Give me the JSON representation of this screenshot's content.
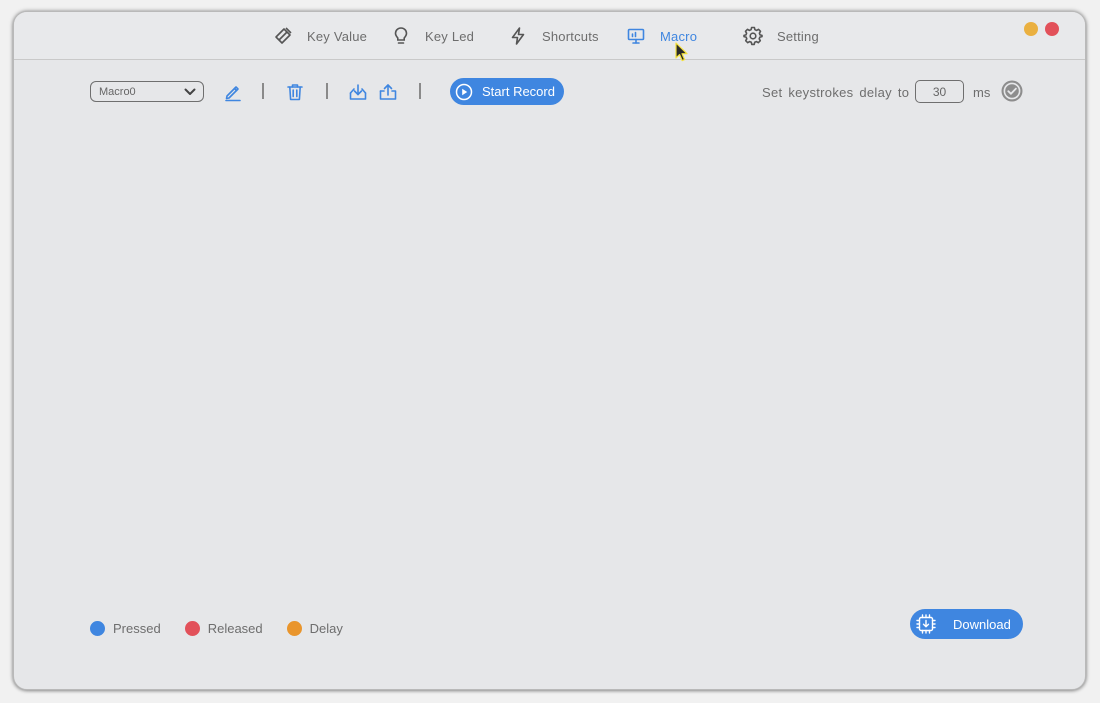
{
  "nav": {
    "tabs": [
      {
        "label": "Key Value",
        "icon": "key-value-icon"
      },
      {
        "label": "Key Led",
        "icon": "bulb-icon"
      },
      {
        "label": "Shortcuts",
        "icon": "lightning-icon"
      },
      {
        "label": "Macro",
        "icon": "monitor-icon",
        "active": true
      },
      {
        "label": "Setting",
        "icon": "gear-icon"
      }
    ]
  },
  "toolbar": {
    "macro_select": {
      "value": "Macro0"
    },
    "record_label": "Start Record",
    "delay_label": "Set keystrokes delay to",
    "delay_value": "30",
    "delay_unit": "ms"
  },
  "legend": {
    "items": [
      {
        "label": "Pressed",
        "color": "#3f86e0"
      },
      {
        "label": "Released",
        "color": "#e2515a"
      },
      {
        "label": "Delay",
        "color": "#e9952c"
      }
    ]
  },
  "footer": {
    "download_label": "Download"
  },
  "colors": {
    "accent": "#3f86e0",
    "minimize": "#eab040",
    "close": "#e2515a"
  }
}
